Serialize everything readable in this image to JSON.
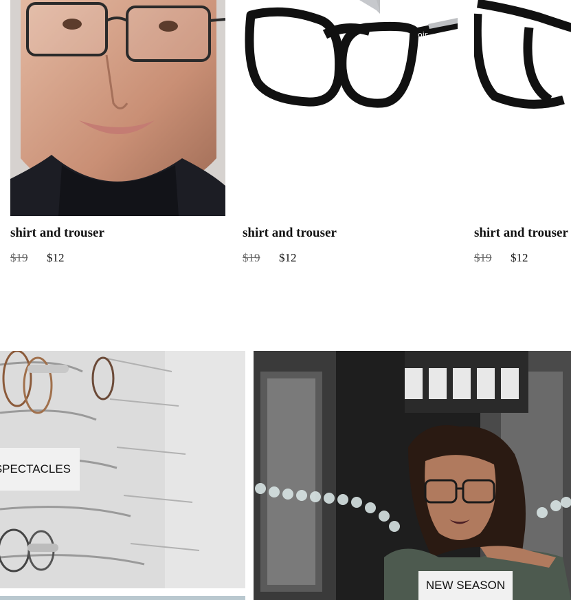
{
  "products": [
    {
      "title": "shirt and trouser",
      "old_price": "$19",
      "price": "$12",
      "image": "model-wearing-glasses"
    },
    {
      "title": "shirt and trouser",
      "old_price": "$19",
      "price": "$12",
      "image": "black-frame-glasses"
    },
    {
      "title": "shirt and trouser",
      "old_price": "$19",
      "price": "$12",
      "image": "black-frame-glasses"
    }
  ],
  "banners": [
    {
      "label": "SPECTACLES",
      "image": "spectacles-display-rack"
    },
    {
      "label": "NEW SEASON",
      "image": "woman-wearing-glasses"
    }
  ]
}
